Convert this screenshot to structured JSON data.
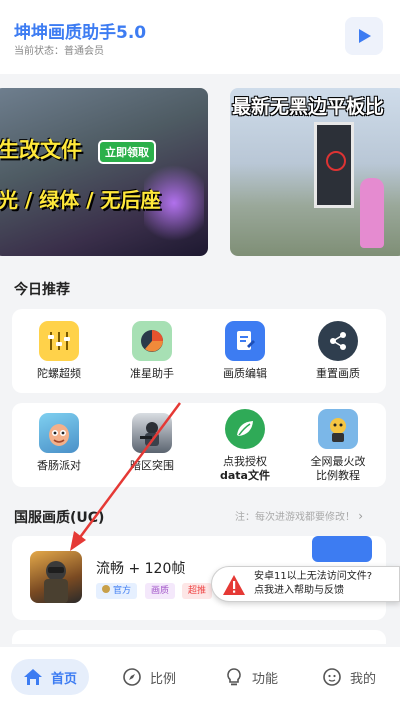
{
  "header": {
    "title": "坤坤画质助手5.0",
    "status": "当前状态：普通会员"
  },
  "banners": [
    {
      "line1": "生改文件",
      "badge": "立即领取",
      "line2": "光 / 绿体 / 无后座"
    },
    {
      "title": "最新无黑边平板比"
    }
  ],
  "today": {
    "title": "今日推荐",
    "row1": [
      {
        "label": "陀螺超频",
        "icon": "gyro-sliders-icon"
      },
      {
        "label": "准星助手",
        "icon": "crosshair-pie-icon"
      },
      {
        "label": "画质编辑",
        "icon": "edit-document-icon"
      },
      {
        "label": "重置画质",
        "icon": "share-reset-icon"
      }
    ],
    "row2": [
      {
        "label": "香肠派对",
        "icon": "sausage-party-game-icon"
      },
      {
        "label": "暗区突围",
        "icon": "arena-breakout-game-icon"
      },
      {
        "label1": "点我授权",
        "label2": "data文件",
        "icon": "leaf-authorize-icon"
      },
      {
        "label1": "全网最火改",
        "label2": "比例教程",
        "icon": "tutorial-character-icon"
      }
    ]
  },
  "region": {
    "title": "国服画质(UC)",
    "note": "注：每次进游戏都要修改！"
  },
  "game": {
    "name": "流畅 + 120帧",
    "tags": [
      "官方",
      "画质",
      "超推"
    ]
  },
  "toast": {
    "line1": "安卓11以上无法访问文件?",
    "line2": "点我进入帮助与反馈"
  },
  "tabs": {
    "home": "首页",
    "ratio": "比例",
    "func": "功能",
    "mine": "我的"
  },
  "colors": {
    "accent": "#3d7cf2",
    "warning": "#e53935",
    "arrow": "#e53935"
  }
}
